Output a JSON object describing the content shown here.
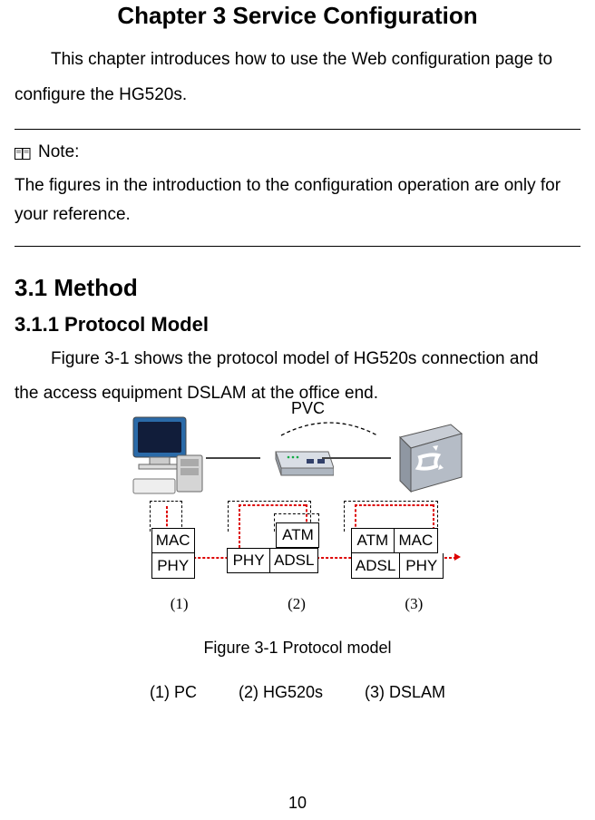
{
  "chapter_title": "Chapter 3  Service Configuration",
  "intro_line1": "This chapter introduces how to use the Web configuration page to",
  "intro_line2": "configure the HG520s.",
  "note": {
    "label": "Note:",
    "body": "The figures in the introduction to the configuration operation are only for your reference."
  },
  "sec1": {
    "h1": "3.1  Method",
    "h2": "3.1.1  Protocol Model",
    "p1": "Figure 3-1 shows the protocol model of HG520s connection and",
    "p2": "the access equipment DSLAM at the office end."
  },
  "figure": {
    "pvc_label": "PVC",
    "stack1": {
      "mac": "MAC",
      "phy": "PHY"
    },
    "stack2": {
      "atm": "ATM",
      "phy": "PHY",
      "adsl": "ADSL"
    },
    "stack3": {
      "atm": "ATM",
      "mac": "MAC",
      "adsl": "ADSL",
      "phy": "PHY"
    },
    "seq": {
      "s1": "(1)",
      "s2": "(2)",
      "s3": "(3)"
    },
    "caption": "Figure 3-1 Protocol model",
    "legend": {
      "l1": "(1) PC",
      "l2": "(2) HG520s",
      "l3": "(3) DSLAM"
    }
  },
  "page_number": "10"
}
